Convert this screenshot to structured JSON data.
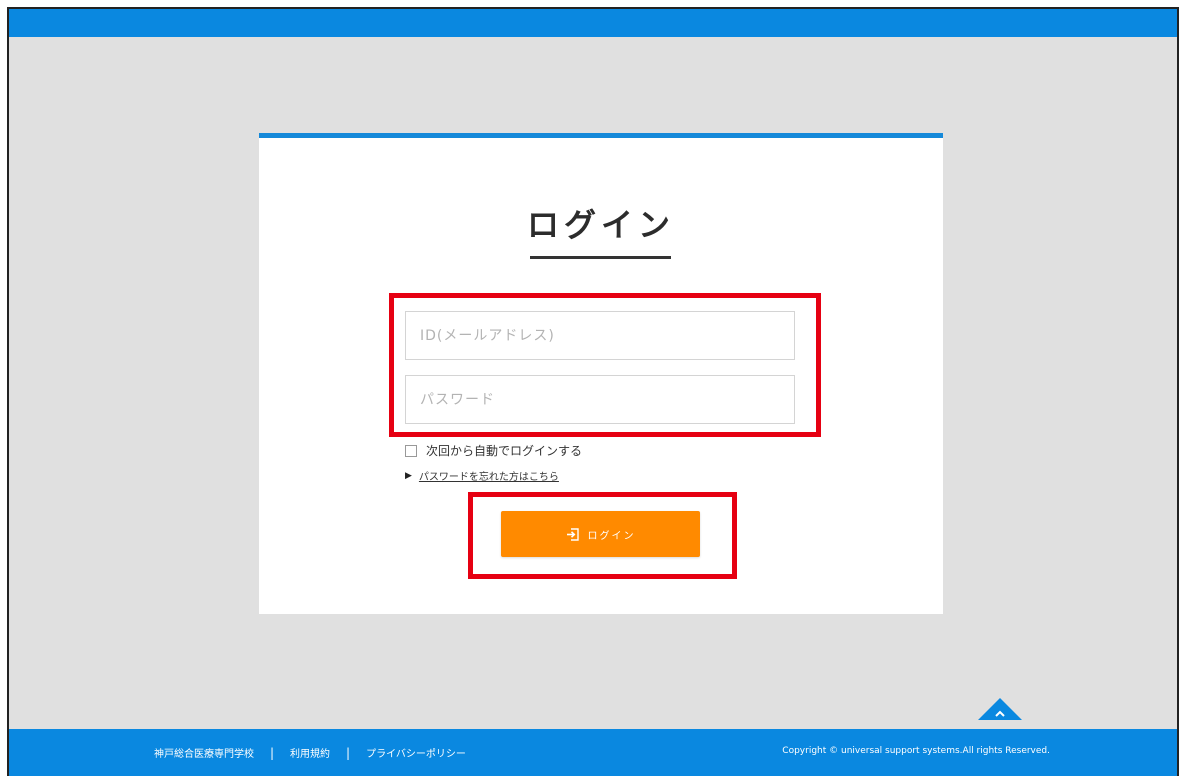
{
  "header": {
    "bar_color": "#0a88e0"
  },
  "login_card": {
    "title": "ログイン",
    "accent_color": "#1589d9",
    "id_placeholder": "ID(メールアドレス)",
    "password_placeholder": "パスワード",
    "remember_label": "次回から自動でログインする",
    "remember_checked": false,
    "forgot_link": "パスワードを忘れた方はこちら",
    "login_button_label": "ログイン",
    "login_button_icon": "sign-in-icon",
    "login_button_color": "#ff8a00",
    "highlight_color": "#e60012"
  },
  "footer": {
    "links": [
      "神戸総合医療専門学校",
      "利用規約",
      "プライバシーポリシー"
    ],
    "separator": "|",
    "copyright": "Copyright © universal support systems.All rights Reserved.",
    "back_to_top_icon": "chevron-up-icon",
    "bar_color": "#0a88e0"
  }
}
